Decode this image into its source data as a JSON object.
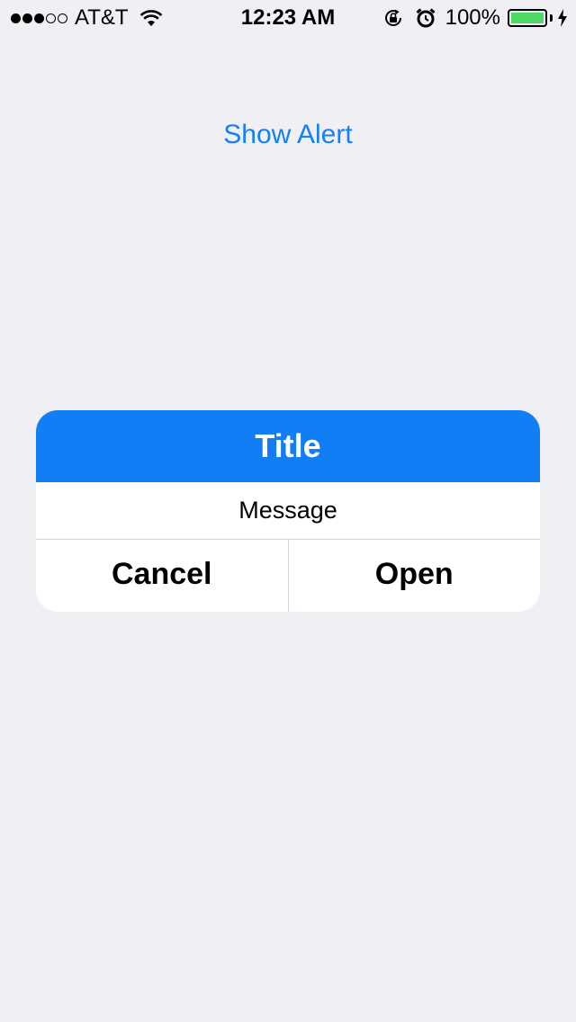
{
  "status_bar": {
    "carrier": "AT&T",
    "time": "12:23 AM",
    "battery_percent": "100%",
    "battery_level": 1.0,
    "signal_bars_filled": 3,
    "signal_bars_total": 5,
    "icons": [
      "wifi-icon",
      "rotation-lock-icon",
      "alarm-icon",
      "battery-icon",
      "charging-icon"
    ]
  },
  "main": {
    "show_alert_label": "Show Alert"
  },
  "alert": {
    "title": "Title",
    "message": "Message",
    "cancel_label": "Cancel",
    "open_label": "Open",
    "title_color": "#127ef6"
  },
  "colors": {
    "accent": "#1480f8",
    "background": "#efeff4",
    "battery_green": "#4cd964"
  }
}
